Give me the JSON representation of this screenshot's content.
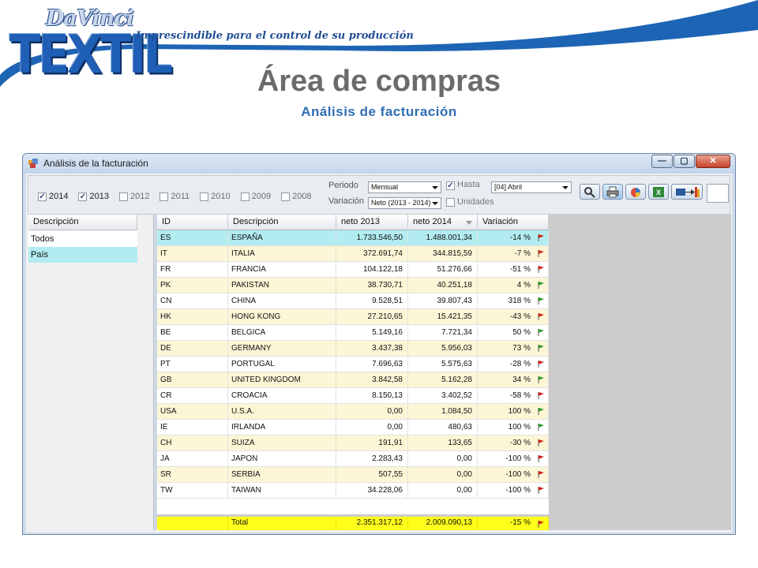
{
  "header": {
    "logo_top": "DaVinci",
    "logo_main": "TEXTIL",
    "tagline": "Imprescindible para el control de su producción",
    "title": "Área de compras",
    "subtitle": "Análisis de facturación"
  },
  "window": {
    "title": "Análisis de la facturación",
    "buttons": {
      "minimize": "—",
      "maximize": "▢",
      "close": "✕"
    }
  },
  "toolbar": {
    "years": [
      {
        "label": "2014",
        "checked": true
      },
      {
        "label": "2013",
        "checked": true
      },
      {
        "label": "2012",
        "checked": false
      },
      {
        "label": "2011",
        "checked": false
      },
      {
        "label": "2010",
        "checked": false
      },
      {
        "label": "2009",
        "checked": false
      },
      {
        "label": "2008",
        "checked": false
      }
    ],
    "periodo_label": "Periodo",
    "periodo_value": "Mensual",
    "variacion_label": "Variación",
    "variacion_value": "Neto (2013 - 2014)",
    "hasta_label": "Hasta",
    "hasta_checked": true,
    "hasta_value": "[04] Abril",
    "unidades_label": "Unidades",
    "unidades_checked": false,
    "icons": [
      "search-icon",
      "print-icon",
      "chart-icon",
      "excel-icon",
      "export-icon"
    ]
  },
  "left_pane": {
    "header": "Descripción",
    "items": [
      "Todos",
      "País"
    ],
    "selected": "País"
  },
  "grid": {
    "columns": [
      "ID",
      "Descripción",
      "neto 2013",
      "neto 2014",
      "Variación"
    ],
    "rows": [
      {
        "id": "ES",
        "desc": "ESPAÑA",
        "n2013": "1.733.546,50",
        "n2014": "1.488.001,34",
        "var": "-14 %",
        "flag": "red"
      },
      {
        "id": "IT",
        "desc": "ITALIA",
        "n2013": "372.691,74",
        "n2014": "344.815,59",
        "var": "-7 %",
        "flag": "red"
      },
      {
        "id": "FR",
        "desc": "FRANCIA",
        "n2013": "104.122,18",
        "n2014": "51.276,66",
        "var": "-51 %",
        "flag": "red"
      },
      {
        "id": "PK",
        "desc": "PAKISTAN",
        "n2013": "38.730,71",
        "n2014": "40.251,18",
        "var": "4 %",
        "flag": "green"
      },
      {
        "id": "CN",
        "desc": "CHINA",
        "n2013": "9.528,51",
        "n2014": "39.807,43",
        "var": "318 %",
        "flag": "green"
      },
      {
        "id": "HK",
        "desc": "HONG KONG",
        "n2013": "27.210,65",
        "n2014": "15.421,35",
        "var": "-43 %",
        "flag": "red"
      },
      {
        "id": "BE",
        "desc": "BELGICA",
        "n2013": "5.149,16",
        "n2014": "7.721,34",
        "var": "50 %",
        "flag": "green"
      },
      {
        "id": "DE",
        "desc": "GERMANY",
        "n2013": "3.437,38",
        "n2014": "5.956,03",
        "var": "73 %",
        "flag": "green"
      },
      {
        "id": "PT",
        "desc": "PORTUGAL",
        "n2013": "7.696,63",
        "n2014": "5.575,63",
        "var": "-28 %",
        "flag": "red"
      },
      {
        "id": "GB",
        "desc": "UNITED KINGDOM",
        "n2013": "3.842,58",
        "n2014": "5.162,28",
        "var": "34 %",
        "flag": "green"
      },
      {
        "id": "CR",
        "desc": "CROACIA",
        "n2013": "8.150,13",
        "n2014": "3.402,52",
        "var": "-58 %",
        "flag": "red"
      },
      {
        "id": "USA",
        "desc": "U.S.A.",
        "n2013": "0,00",
        "n2014": "1.084,50",
        "var": "100 %",
        "flag": "green"
      },
      {
        "id": "IE",
        "desc": "IRLANDA",
        "n2013": "0,00",
        "n2014": "480,63",
        "var": "100 %",
        "flag": "green"
      },
      {
        "id": "CH",
        "desc": "SUIZA",
        "n2013": "191,91",
        "n2014": "133,65",
        "var": "-30 %",
        "flag": "red"
      },
      {
        "id": "JA",
        "desc": "JAPON",
        "n2013": "2.283,43",
        "n2014": "0,00",
        "var": "-100 %",
        "flag": "red"
      },
      {
        "id": "SR",
        "desc": "SERBIA",
        "n2013": "507,55",
        "n2014": "0,00",
        "var": "-100 %",
        "flag": "red"
      },
      {
        "id": "TW",
        "desc": "TAIWAN",
        "n2013": "34.228,06",
        "n2014": "0,00",
        "var": "-100 %",
        "flag": "red"
      }
    ],
    "total": {
      "label": "Total",
      "n2013": "2.351.317,12",
      "n2014": "2.009.090,13",
      "var": "-15 %",
      "flag": "red"
    }
  },
  "colors": {
    "selected_row": "#b2ecf0",
    "alt_row": "#fdf6d6",
    "total_row": "#ffff1a",
    "flag_red": "#d0231a",
    "flag_green": "#2a9a2a",
    "title_gray": "#6b6b6b",
    "subtitle_blue": "#2f6eb3"
  }
}
